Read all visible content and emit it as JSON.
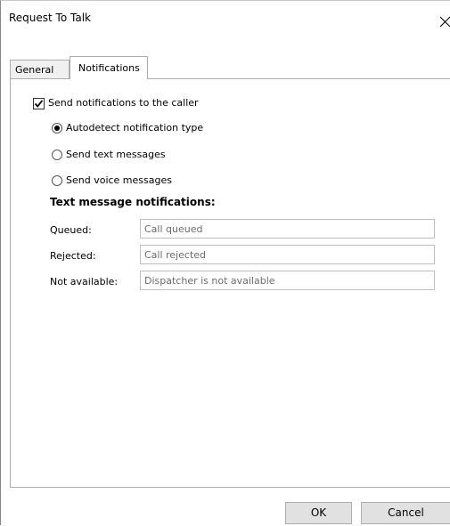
{
  "window": {
    "title": "Request To Talk"
  },
  "tabs": [
    {
      "label": "General",
      "active": false
    },
    {
      "label": "Notifications",
      "active": true
    }
  ],
  "notifications": {
    "send_to_caller": {
      "label": "Send notifications to the caller",
      "checked": true
    },
    "type_options": [
      {
        "label": "Autodetect notification type",
        "selected": true
      },
      {
        "label": "Send text messages",
        "selected": false
      },
      {
        "label": "Send voice messages",
        "selected": false
      }
    ],
    "text_messages_heading": "Text message notifications:",
    "fields": [
      {
        "label": "Queued:",
        "value": "Call queued"
      },
      {
        "label": "Rejected:",
        "value": "Call rejected"
      },
      {
        "label": "Not available:",
        "value": "Dispatcher is not available"
      }
    ]
  },
  "buttons": {
    "ok": "OK",
    "cancel": "Cancel"
  },
  "icons": {
    "close": "close-icon",
    "check": "check-icon"
  },
  "colors": {
    "window_bg": "#ffffff",
    "tab_border": "#adadad",
    "button_bg": "#e1e1e1",
    "input_text": "#6d6d6d"
  }
}
